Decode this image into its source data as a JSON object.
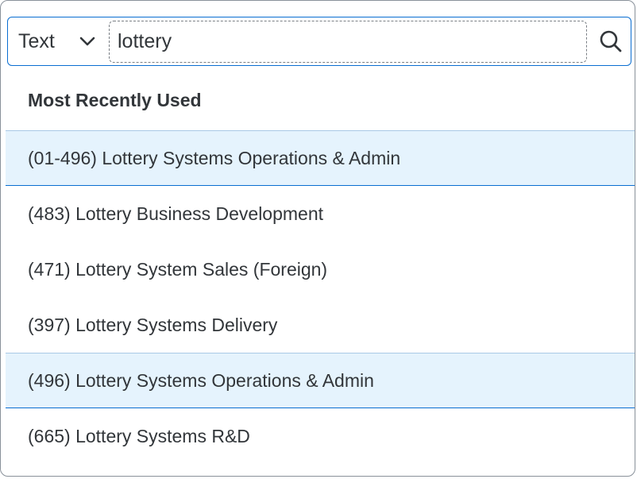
{
  "search": {
    "type_label": "Text",
    "value": "lottery",
    "search_button_label": "Search"
  },
  "section": {
    "title": "Most Recently Used"
  },
  "items": [
    {
      "label": "(01-496) Lottery Systems Operations & Admin",
      "selected": true
    },
    {
      "label": "(483) Lottery Business Development",
      "selected": false
    },
    {
      "label": "(471) Lottery System Sales (Foreign)",
      "selected": false
    },
    {
      "label": "(397) Lottery Systems Delivery",
      "selected": false
    },
    {
      "label": "(496) Lottery Systems Operations & Admin",
      "selected": true
    },
    {
      "label": "(665) Lottery Systems R&D",
      "selected": false
    }
  ],
  "colors": {
    "accent": "#0a6ed1",
    "selected_background": "#e5f3fd",
    "text": "#32363a",
    "border": "#89919a"
  },
  "icons": {
    "type_dropdown": "chevron-down-icon",
    "search": "search-icon"
  }
}
